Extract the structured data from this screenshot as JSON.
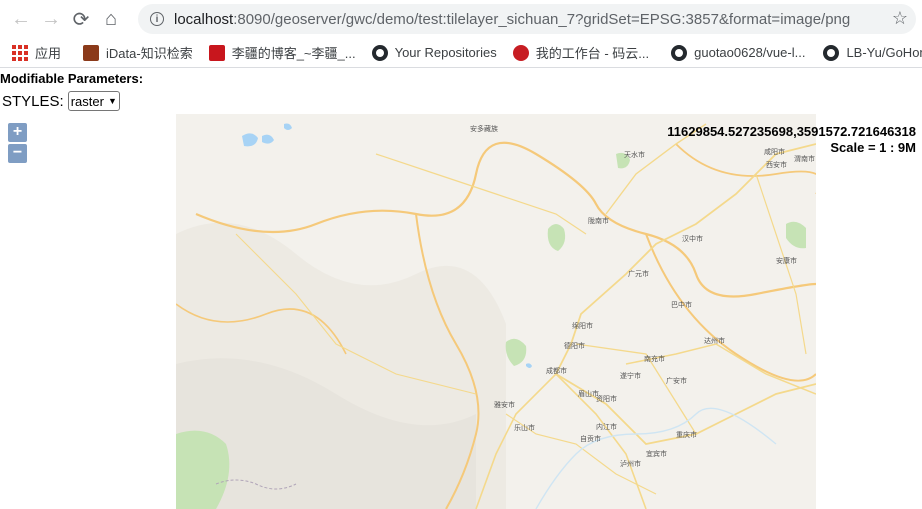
{
  "browser": {
    "url_host": "localhost",
    "url_path": ":8090/geoserver/gwc/demo/test:tilelayer_sichuan_7?gridSet=EPSG:3857&format=image/png"
  },
  "bookmarks": [
    {
      "label": "应用",
      "icon": "apps-icon"
    },
    {
      "label": "iData-知识检索",
      "icon": "idata-icon"
    },
    {
      "label": "李疆的博客_~李疆_...",
      "icon": "csdn-icon"
    },
    {
      "label": "Your Repositories",
      "icon": "github-icon"
    },
    {
      "label": "我的工作台 - 码云...",
      "icon": "gitee-icon"
    },
    {
      "label": "guotao0628/vue-l...",
      "icon": "github-icon"
    },
    {
      "label": "LB-Yu/GoHome:",
      "icon": "github-icon"
    }
  ],
  "page": {
    "params_title": "Modifiable Parameters:",
    "styles_label": "STYLES:",
    "styles_value": "raster",
    "coords": "11629854.527235698,3591572.721646318",
    "scale": "Scale = 1 : 9M",
    "zoom_in": "+",
    "zoom_out": "−"
  },
  "map": {
    "cities": [
      "安多藏族",
      "天水市",
      "西安市",
      "咸阳市",
      "渭南市",
      "陇南市",
      "汉中市",
      "安康市",
      "广元市",
      "巴中市",
      "绵阳市",
      "达州市",
      "德阳市",
      "南充市",
      "成都市",
      "遂宁市",
      "广安市",
      "资阳市",
      "眉山市",
      "雅安市",
      "乐山市",
      "内江市",
      "自贡市",
      "重庆市",
      "宜宾市",
      "泸州市"
    ],
    "colors": {
      "background": "#f3f1ec",
      "province_border": "#f5c97a",
      "road": "#f4d98c",
      "water": "#a7d3f5",
      "forest": "#c6e3b5"
    }
  }
}
